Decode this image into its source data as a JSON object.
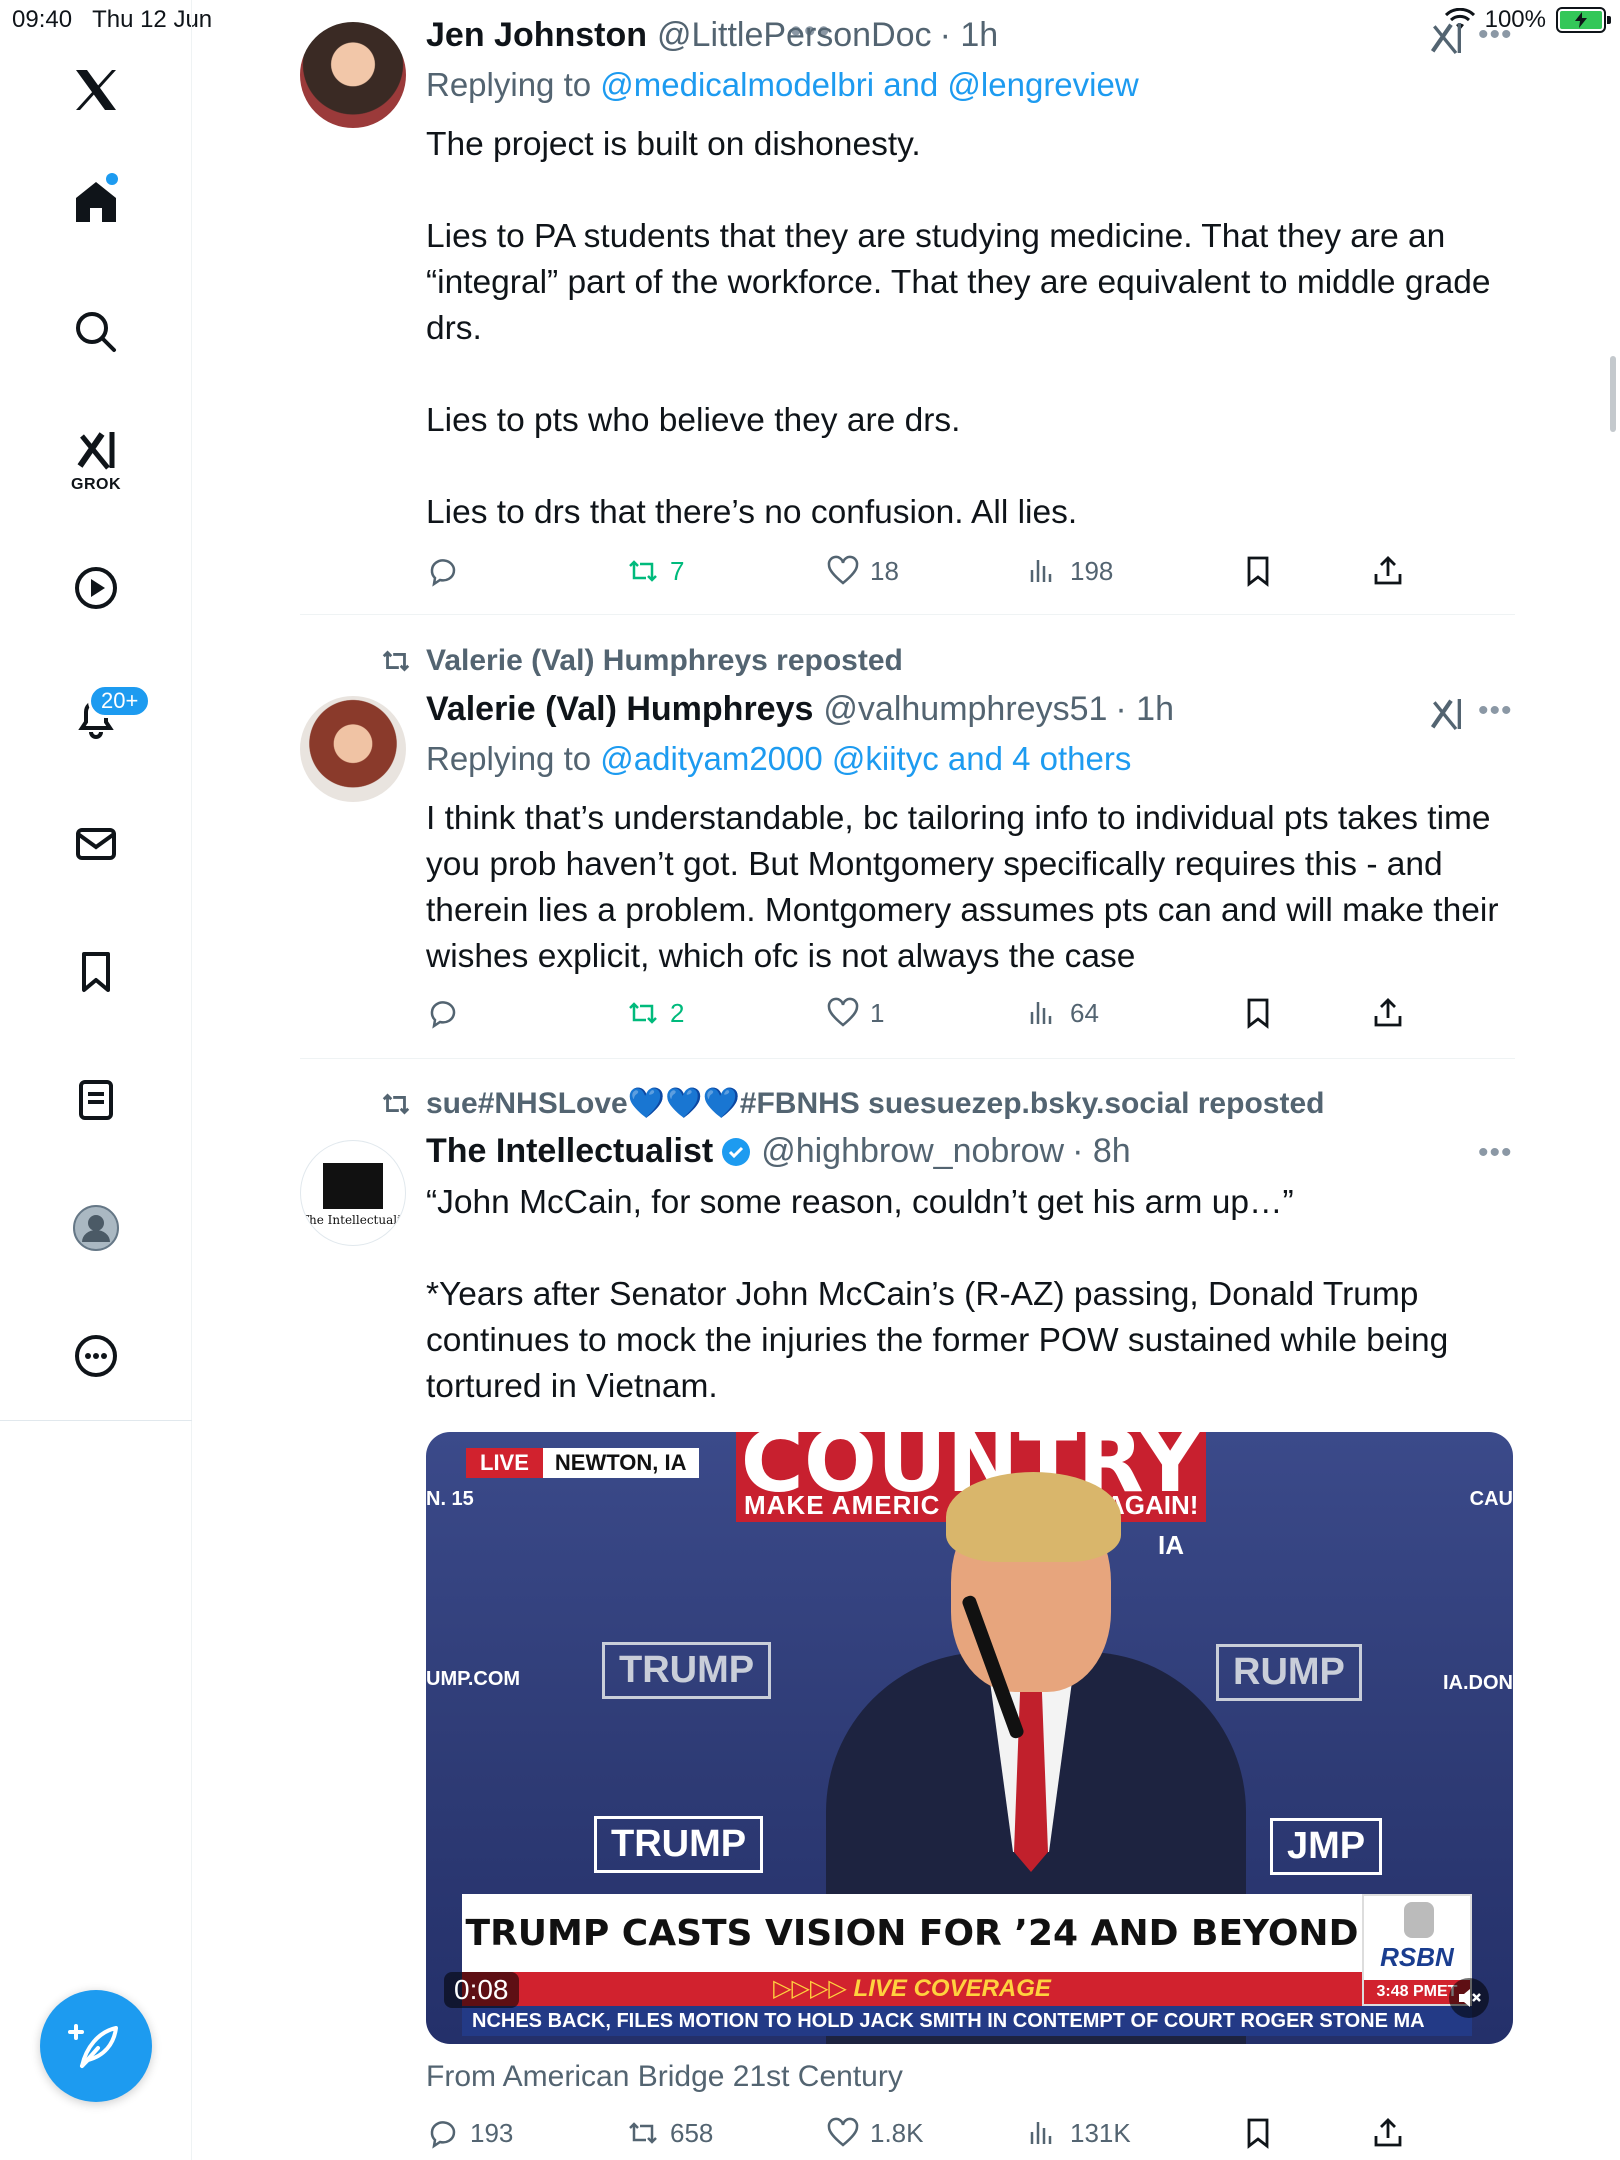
{
  "status_bar": {
    "time": "09:40",
    "date": "Thu 12 Jun",
    "battery": "100%"
  },
  "sidebar": {
    "items": [
      {
        "name": "x-logo"
      },
      {
        "name": "home"
      },
      {
        "name": "search"
      },
      {
        "name": "grok",
        "label": "GROK"
      },
      {
        "name": "videos"
      },
      {
        "name": "notifications",
        "badge": "20+"
      },
      {
        "name": "messages"
      },
      {
        "name": "bookmarks"
      },
      {
        "name": "lists"
      },
      {
        "name": "profile"
      },
      {
        "name": "more"
      }
    ]
  },
  "posts": [
    {
      "name": "Jen Johnston",
      "handle": "@LittlePersonDoc",
      "time": "· 1h",
      "replying_prefix": "Replying to ",
      "replying_to": "@medicalmodelbri and @lengreview",
      "text": "The project is built on dishonesty.\n\nLies to PA students that they are studying medicine. That they are an “integral” part of the workforce. That they are equivalent to middle grade drs.\n\nLies to pts who believe they are drs.\n\nLies to drs that there’s no confusion. All lies.",
      "replies": "",
      "reposts": "7",
      "likes": "18",
      "views": "198"
    },
    {
      "reposted_by": "Valerie (Val) Humphreys reposted",
      "name": "Valerie (Val) Humphreys",
      "handle": "@valhumphreys51",
      "time": "· 1h",
      "replying_prefix": "Replying to ",
      "replying_to": "@adityam2000 @kiityc and 4 others",
      "text": "I think that’s understandable, bc tailoring info to individual pts takes time you prob haven’t got. But Montgomery specifically requires this - and therein lies a problem. Montgomery assumes pts can and will make their wishes explicit, which ofc is not always the case",
      "replies": "",
      "reposts": "2",
      "likes": "1",
      "views": "64"
    },
    {
      "reposted_by": "sue#NHSLove💙💙💙#FBNHS suesuezep.bsky.social reposted",
      "name": "The Intellectualist",
      "verified": true,
      "handle": "@highbrow_nobrow",
      "time": "· 8h",
      "avatar_text": "The Intellectualist",
      "text": "“John McCain, for some reason, couldn’t get his arm up…”\n\n*Years after Senator John McCain’s (R-AZ) passing, Donald Trump continues to mock the injuries the former POW sustained while being tortured in Vietnam.",
      "video": {
        "banner": "COUNTRY",
        "live": "LIVE",
        "location": "NEWTON, IA",
        "make": "MAKE AMERIC",
        "again": "AGAIN!",
        "ia": "IA",
        "left_edge_1": "N. 15",
        "left_edge_2": "UMP.COM",
        "right_edge_1": "CAU",
        "right_edge_2": "IA.DON",
        "sign_left": "TRUMP",
        "sign_right": "RUMP",
        "sign_bottom": "TRUMP",
        "sign_bottom_right": "JMP",
        "headline": "TRUMP CASTS VISION FOR ’24 AND BEYOND",
        "live_coverage": "▷▷▷▷ LIVE COVERAGE",
        "ticker": "NCHES BACK, FILES MOTION TO HOLD JACK SMITH IN CONTEMPT OF COURT    ROGER STONE MA",
        "rsbn": "RSBN",
        "rsbn_time": "3:48 PMET",
        "timer": "0:08"
      },
      "from": "From American Bridge 21st Century",
      "replies": "193",
      "reposts": "658",
      "likes": "1.8K",
      "views": "131K"
    }
  ],
  "colors": {
    "accent": "#1d9bf0",
    "repost_green": "#00ba7c",
    "secondary_text": "#536471",
    "primary_text": "#0f1419"
  }
}
